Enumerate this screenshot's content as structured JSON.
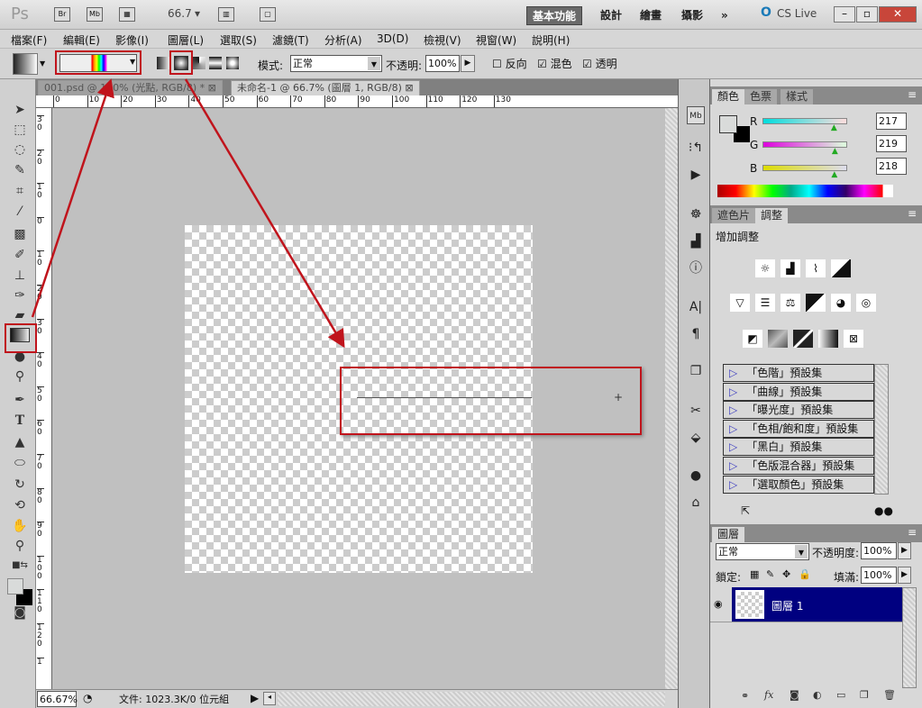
{
  "app": {
    "logo": "Ps",
    "bridge": "Br",
    "minibridge": "Mb",
    "zoom": "66.7",
    "workspaces": [
      "基本功能",
      "設計",
      "繪畫",
      "攝影"
    ],
    "more": "»",
    "cslive": "CS Live"
  },
  "menu": [
    "檔案(F)",
    "編輯(E)",
    "影像(I)",
    "圖層(L)",
    "選取(S)",
    "濾鏡(T)",
    "分析(A)",
    "3D(D)",
    "檢視(V)",
    "視窗(W)",
    "說明(H)"
  ],
  "options": {
    "mode_label": "模式:",
    "mode_value": "正常",
    "opacity_label": "不透明:",
    "opacity_value": "100%",
    "reverse": "反向",
    "dither": "混色",
    "transparency": "透明",
    "reverse_checked": false,
    "dither_checked": true,
    "transparency_checked": true
  },
  "tabs": [
    {
      "label": "001.psd @ 100% (光點, RGB/8) *"
    },
    {
      "label": "未命名-1 @ 66.7% (圖層 1, RGB/8)"
    }
  ],
  "ruler_top": [
    "0",
    "10",
    "20",
    "30",
    "40",
    "50",
    "60",
    "70",
    "80",
    "90",
    "100",
    "110",
    "120",
    "130"
  ],
  "ruler_left": [
    "30",
    "20",
    "10",
    "0",
    "10",
    "20",
    "30",
    "40",
    "50",
    "60",
    "70",
    "80",
    "90",
    "100",
    "110",
    "120",
    "1"
  ],
  "status": {
    "zoom": "66.67%",
    "doc": "文件: 1023.3K/0 位元組"
  },
  "color_panel": {
    "tabs": [
      "顏色",
      "色票",
      "樣式"
    ],
    "r_label": "R",
    "g_label": "G",
    "b_label": "B",
    "r": "217",
    "g": "219",
    "b": "218",
    "r_frac": 0.85,
    "g_frac": 0.86,
    "b_frac": 0.855,
    "foreground": "#d9dbda",
    "background": "#000000"
  },
  "adjust_panel": {
    "tabs": [
      "遮色片",
      "調整"
    ],
    "title": "增加調整",
    "presets": [
      "「色階」預設集",
      "「曲線」預設集",
      "「曝光度」預設集",
      "「色相/飽和度」預設集",
      "「黑白」預設集",
      "「色版混合器」預設集",
      "「選取顏色」預設集"
    ]
  },
  "layers_panel": {
    "tab": "圖層",
    "blend": "正常",
    "opacity_label": "不透明度:",
    "opacity": "100%",
    "lock_label": "鎖定:",
    "fill_label": "填滿:",
    "fill": "100%",
    "layers": [
      {
        "name": "圖層 1",
        "selected": true
      }
    ]
  },
  "colors": {
    "accent": "#c0141c",
    "layer_selected": "#000080"
  }
}
